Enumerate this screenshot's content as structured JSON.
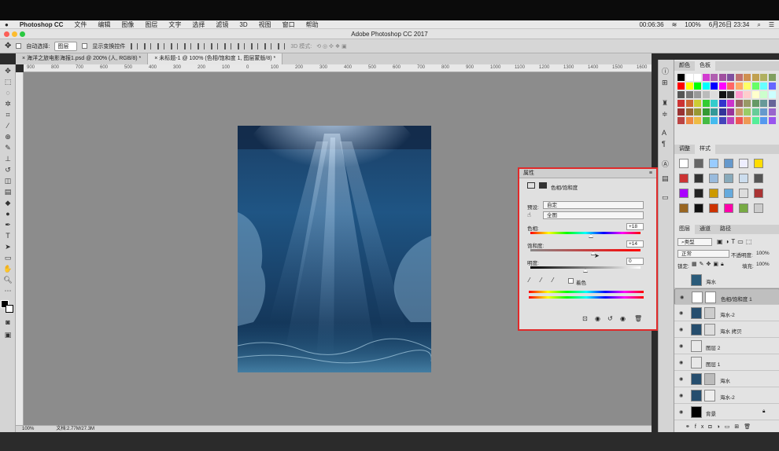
{
  "os_menu": {
    "app_name": "Photoshop CC",
    "items": [
      "文件",
      "编辑",
      "图像",
      "图层",
      "文字",
      "选择",
      "滤镜",
      "3D",
      "视图",
      "窗口",
      "帮助"
    ],
    "status": {
      "time_left": "00:06:36",
      "battery": "100%",
      "date_time": "6月26日 23:34"
    }
  },
  "window": {
    "title": "Adobe Photoshop CC 2017"
  },
  "options_bar": {
    "auto_select_label": "自动选择:",
    "auto_select_value": "图层",
    "show_transform_label": "显示变换控件",
    "mode_3d_label": "3D 模式:"
  },
  "doc_tabs": [
    {
      "label": "海洋之旅电影海报1.psd @ 200% (人, RGB/8) *"
    },
    {
      "label": "未标题-1 @ 100% (色相/饱和度 1, 图层蒙版/8) *"
    }
  ],
  "ruler_ticks": [
    "900",
    "800",
    "700",
    "600",
    "500",
    "400",
    "300",
    "200",
    "100",
    "0",
    "100",
    "200",
    "300",
    "400",
    "500",
    "600",
    "700",
    "800",
    "900",
    "1000",
    "1100",
    "1200",
    "1300",
    "1400",
    "1500",
    "1600"
  ],
  "status_bar": {
    "zoom": "100%",
    "doc_size": "文档:2.77M/27.3M"
  },
  "swatches_panel": {
    "tabs": [
      "颜色",
      "色板"
    ]
  },
  "styles_panel": {
    "tabs": [
      "调整",
      "样式"
    ]
  },
  "properties_panel": {
    "tab": "属性",
    "type_label": "色相/饱和度",
    "preset_label": "预设:",
    "preset_value": "自定",
    "channel_value": "全图",
    "hue_label": "色相:",
    "hue_value": "+18",
    "hue": 18,
    "saturation_label": "饱和度:",
    "saturation_value": "+14",
    "saturation": 14,
    "lightness_label": "明度:",
    "lightness_value": "0",
    "lightness": 0,
    "colorize_label": "着色"
  },
  "layers_panel": {
    "tabs": [
      "图层",
      "通道",
      "路径"
    ],
    "filter_kind": "类型",
    "blend_mode": "正常",
    "opacity_label": "不透明度:",
    "opacity_value": "100%",
    "lock_label": "锁定:",
    "fill_label": "填充:",
    "fill_value": "100%",
    "layers": [
      {
        "name": "海水"
      },
      {
        "name": "色相/饱和度 1"
      },
      {
        "name": "海水-2"
      },
      {
        "name": "海水 拷贝"
      },
      {
        "name": "图层 2"
      },
      {
        "name": "图层 1"
      },
      {
        "name": "海水"
      },
      {
        "name": "海水-2"
      },
      {
        "name": "背景"
      }
    ]
  },
  "colors": {
    "highlight_border": "#e02a2a",
    "canvas_bg": "#8c8c8c"
  }
}
